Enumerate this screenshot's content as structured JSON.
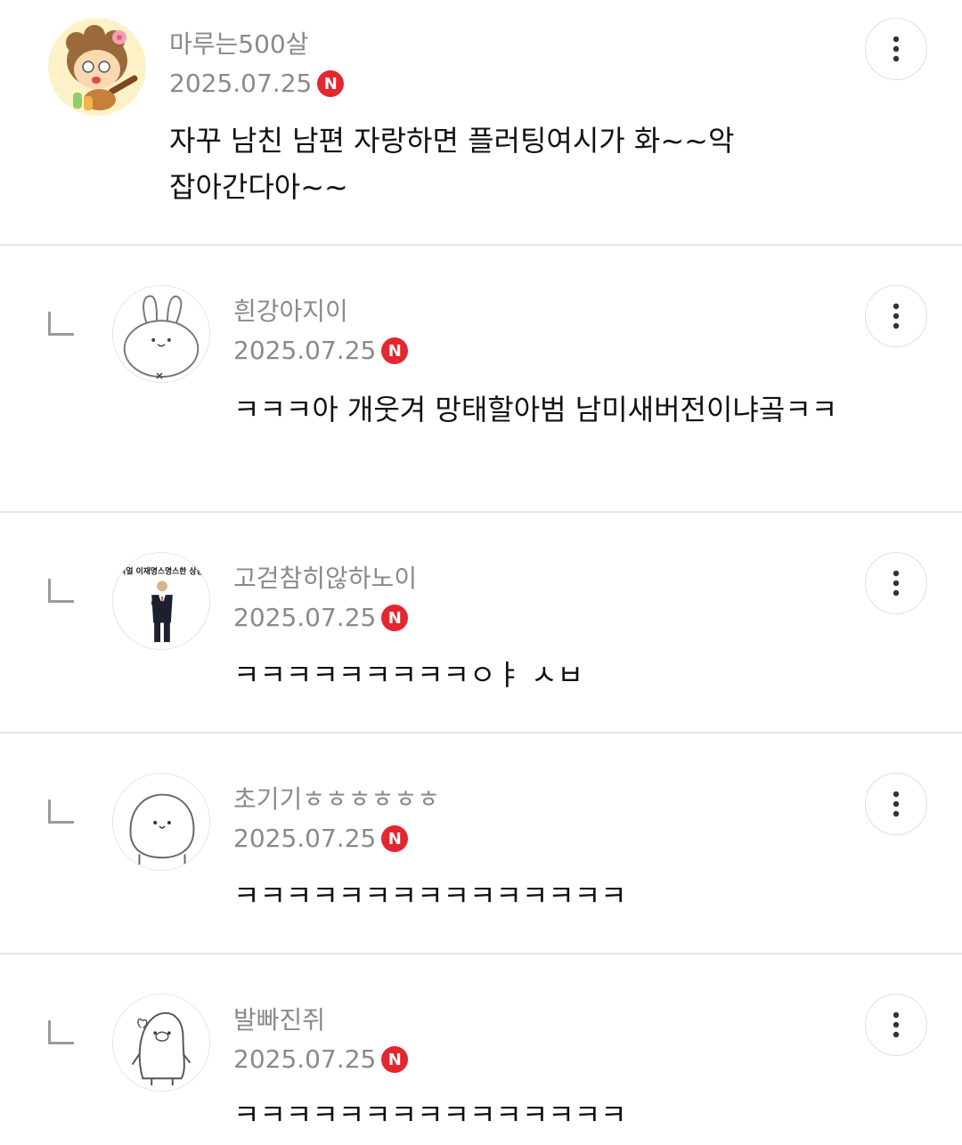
{
  "comments": [
    {
      "nickname": "마루는500살",
      "date": "2025.07.25",
      "badge": "N",
      "text": "자꾸 남친 남편 자랑하면 플러팅여시가 화~~악 잡아간다아~~",
      "avatar": "character-with-guitar-avatar",
      "is_reply": false
    },
    {
      "nickname": "흰강아지이",
      "date": "2025.07.25",
      "badge": "N",
      "text": "ㅋㅋㅋ아 개웃겨 망태할아범 남미새버전이냐곸ㅋㅋ",
      "avatar": "white-bunny-avatar",
      "is_reply": true
    },
    {
      "nickname": "고걷참히않하노이",
      "date": "2025.07.25",
      "badge": "N",
      "text": "ㅋㅋㅋㅋㅋㅋㅋㅋㅋㅇㅑ ㅅㅂ",
      "avatar": "man-in-suit-avatar",
      "avatar_caption": "리얼 이재명스명스한 상황",
      "is_reply": true
    },
    {
      "nickname": "초기기ㅎㅎㅎㅎㅎㅎ",
      "date": "2025.07.25",
      "badge": "N",
      "text": "ㅋㅋㅋㅋㅋㅋㅋㅋㅋㅋㅋㅋㅋㅋㅋ",
      "avatar": "white-blob-avatar",
      "is_reply": true
    },
    {
      "nickname": "발빠진쥐",
      "date": "2025.07.25",
      "badge": "N",
      "text": "ㅋㅋㅋㅋㅋㅋㅋㅋㅋㅋㅋㅋㅋㅋㅋ",
      "avatar": "penguin-character-avatar",
      "is_reply": true
    }
  ],
  "colors": {
    "meta_text": "#8a8a8a",
    "body_text": "#111111",
    "badge_bg": "#e5262e",
    "divider": "#e6e6e6"
  },
  "icons": {
    "more": "vertical-dots-icon",
    "reply": "reply-arrow-icon",
    "new_badge": "n-new-badge"
  }
}
